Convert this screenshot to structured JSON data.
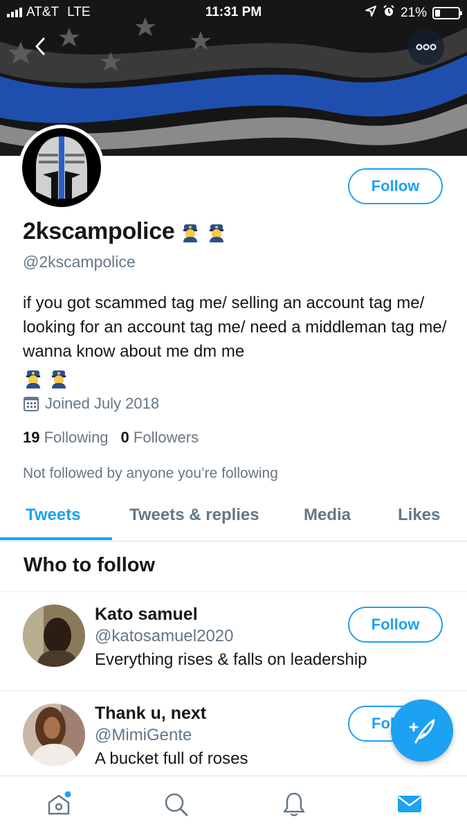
{
  "status_bar": {
    "carrier": "AT&T",
    "network": "LTE",
    "time": "11:31 PM",
    "battery": "21%"
  },
  "profile": {
    "display_name": "2kscampolice",
    "handle": "@2kscampolice",
    "bio": "if you got scammed tag me/ selling an account tag me/ looking for an account tag me/ need a middleman tag me/ wanna know about me dm me",
    "joined": "Joined July 2018",
    "following_count": "19",
    "following_label": "Following",
    "followers_count": "0",
    "followers_label": "Followers",
    "not_followed_text": "Not followed by anyone you’re following",
    "follow_label": "Follow"
  },
  "tabs": [
    {
      "label": "Tweets",
      "active": true
    },
    {
      "label": "Tweets & replies",
      "active": false
    },
    {
      "label": "Media",
      "active": false
    },
    {
      "label": "Likes",
      "active": false
    }
  ],
  "who_to_follow": {
    "title": "Who to follow",
    "suggestions": [
      {
        "name": "Kato samuel",
        "handle": "@katosamuel2020",
        "bio": "Everything rises & falls on leadership",
        "follow_label": "Follow"
      },
      {
        "name": "Thank u, next",
        "handle": "@MimiGente",
        "bio": "A bucket full of roses",
        "follow_label": "Fol"
      }
    ]
  },
  "nav": {
    "items": [
      "home-icon",
      "search-icon",
      "notifications-icon",
      "messages-icon"
    ],
    "active": "messages-icon"
  },
  "colors": {
    "accent": "#1da1f2",
    "secondary_text": "#657786",
    "primary_text": "#14171a"
  }
}
